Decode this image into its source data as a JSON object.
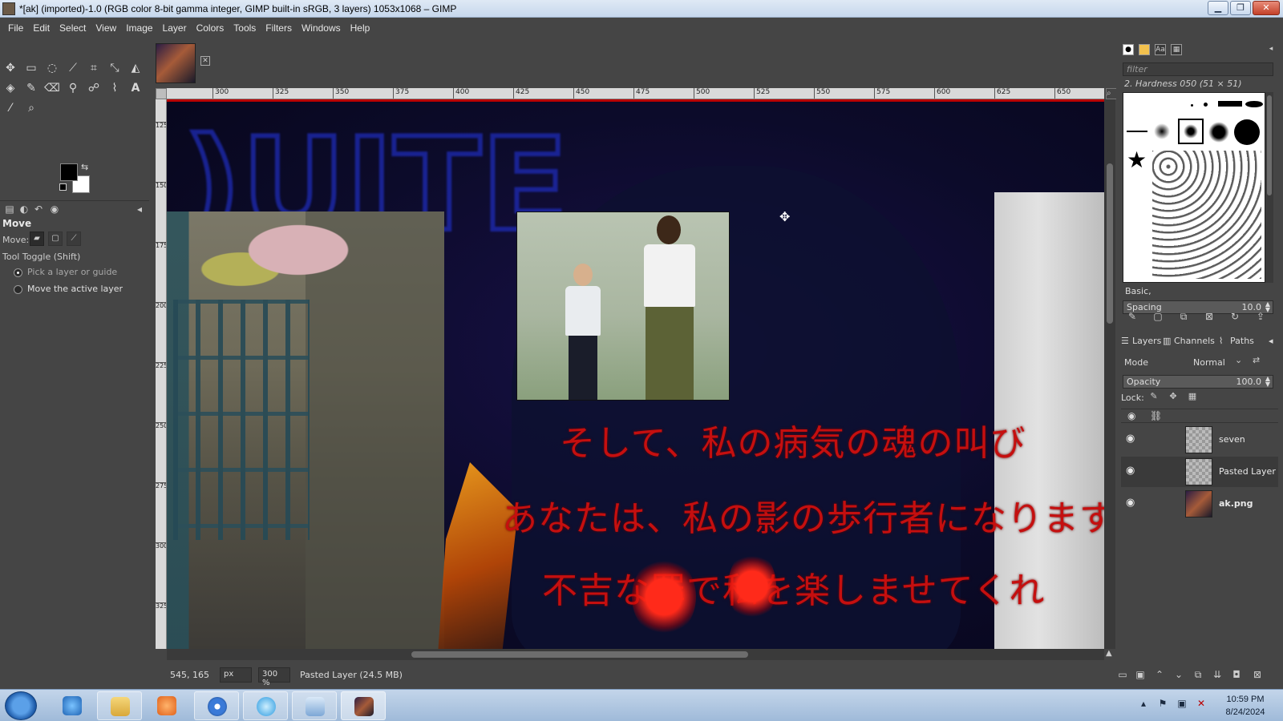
{
  "window": {
    "title": "*[ak] (imported)-1.0 (RGB color 8-bit gamma integer, GIMP built-in sRGB, 3 layers) 1053x1068 – GIMP"
  },
  "menu": [
    "File",
    "Edit",
    "Select",
    "View",
    "Image",
    "Layer",
    "Colors",
    "Tools",
    "Filters",
    "Windows",
    "Help"
  ],
  "tool_options": {
    "title": "Move",
    "move_label": "Move:",
    "toggle_label": "Tool Toggle  (Shift)",
    "radio1": "Pick a layer or guide",
    "radio2": "Move the active layer"
  },
  "rulers": {
    "h_ticks": [
      "300",
      "325",
      "350",
      "375",
      "400",
      "425",
      "450",
      "475",
      "500",
      "525",
      "550",
      "575",
      "600",
      "625",
      "650"
    ],
    "v_ticks": [
      "125",
      "150",
      "175",
      "200",
      "225",
      "250",
      "275",
      "300",
      "325"
    ]
  },
  "canvas": {
    "jp_line1": "そして、私の病気の魂の叫び",
    "jp_line2": "あなたは、私の影の歩行者になります",
    "jp_line3": "不吉な罪で私を楽しませてくれ"
  },
  "status": {
    "coords": "545, 165",
    "unit": "px",
    "zoom": "300 %",
    "layer_info": "Pasted Layer (24.5 MB)"
  },
  "brushes": {
    "filter_placeholder": "filter",
    "current": "2. Hardness 050 (51 × 51)",
    "preset": "Basic,",
    "spacing_label": "Spacing",
    "spacing_value": "10.0"
  },
  "layers": {
    "tabs": [
      "Layers",
      "Channels",
      "Paths"
    ],
    "mode_label": "Mode",
    "mode_value": "Normal",
    "opacity_label": "Opacity",
    "opacity_value": "100.0",
    "lock_label": "Lock:",
    "items": [
      {
        "name": "seven"
      },
      {
        "name": "Pasted Layer"
      },
      {
        "name": "ak.png"
      }
    ]
  },
  "taskbar": {
    "time": "10:59 PM",
    "date": "8/24/2024"
  },
  "colors": {
    "foreground": "#000000",
    "background": "#ffffff",
    "text_red": "#c50f0f"
  }
}
